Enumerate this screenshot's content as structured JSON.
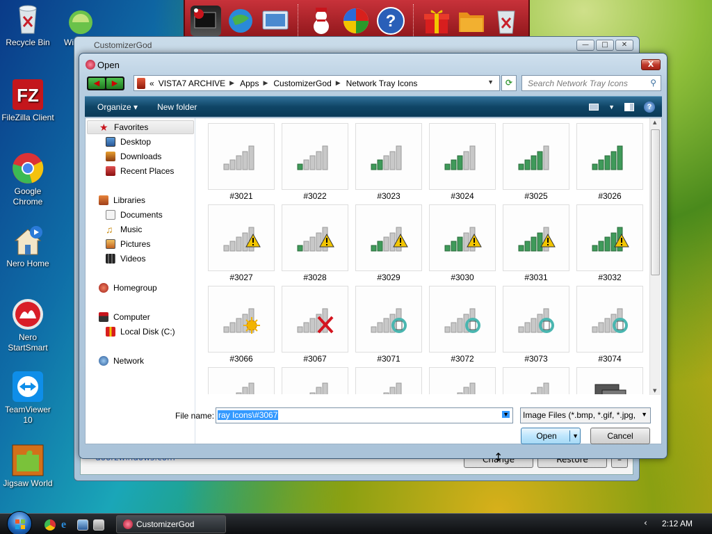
{
  "desktop": {
    "icons": [
      {
        "label": "Recycle Bin",
        "icon": "recycle-bin-icon"
      },
      {
        "label": "FileZilla Client",
        "icon": "filezilla-icon"
      },
      {
        "label": "Google Chrome",
        "icon": "chrome-icon"
      },
      {
        "label": "Nero Home",
        "icon": "nero-home-icon"
      },
      {
        "label": "Nero StartSmart",
        "icon": "nero-startsmart-icon"
      },
      {
        "label": "TeamViewer 10",
        "icon": "teamviewer-icon"
      },
      {
        "label": "Jigsaw World",
        "icon": "jigsaw-icon"
      },
      {
        "label": "Wi L",
        "icon": "windows-live-icon"
      }
    ]
  },
  "toolbar_icons": [
    "computer-santa-icon",
    "network-globe-icon",
    "display-icon",
    "snowman-icon",
    "security-shield-icon",
    "help-icon",
    "gift-icon",
    "folder-icon",
    "recycle-bin-icon"
  ],
  "back_window": {
    "title": "CustomizerGod",
    "link_text": "doorzwindows.com",
    "change_label": "Change",
    "restore_label": "Restore",
    "minus_label": "–"
  },
  "dialog": {
    "title": "Open",
    "close_label": "X",
    "address": {
      "prefix": "«",
      "crumbs": [
        "VISTA7 ARCHIVE",
        "Apps",
        "CustomizerGod",
        "Network Tray Icons"
      ]
    },
    "search_placeholder": "Search Network Tray Icons",
    "commands": {
      "organize": "Organize ▾",
      "new_folder": "New folder"
    },
    "nav": {
      "favorites": "Favorites",
      "desktop": "Desktop",
      "downloads": "Downloads",
      "recent": "Recent Places",
      "libraries": "Libraries",
      "documents": "Documents",
      "music": "Music",
      "pictures": "Pictures",
      "videos": "Videos",
      "homegroup": "Homegroup",
      "computer": "Computer",
      "local_disk": "Local Disk (C:)",
      "network": "Network"
    },
    "files": [
      {
        "name": "#3021",
        "bars": 0,
        "overlay": "none"
      },
      {
        "name": "#3022",
        "bars": 1,
        "overlay": "none"
      },
      {
        "name": "#3023",
        "bars": 2,
        "overlay": "none"
      },
      {
        "name": "#3024",
        "bars": 3,
        "overlay": "none"
      },
      {
        "name": "#3025",
        "bars": 4,
        "overlay": "none"
      },
      {
        "name": "#3026",
        "bars": 5,
        "overlay": "none"
      },
      {
        "name": "#3027",
        "bars": 0,
        "overlay": "warning"
      },
      {
        "name": "#3028",
        "bars": 1,
        "overlay": "warning"
      },
      {
        "name": "#3029",
        "bars": 2,
        "overlay": "warning"
      },
      {
        "name": "#3030",
        "bars": 3,
        "overlay": "warning"
      },
      {
        "name": "#3031",
        "bars": 4,
        "overlay": "warning"
      },
      {
        "name": "#3032",
        "bars": 5,
        "overlay": "warning"
      },
      {
        "name": "#3066",
        "bars": 0,
        "overlay": "sun"
      },
      {
        "name": "#3067",
        "bars": 0,
        "overlay": "error"
      },
      {
        "name": "#3071",
        "bars": 0,
        "overlay": "busy"
      },
      {
        "name": "#3072",
        "bars": 0,
        "overlay": "busy"
      },
      {
        "name": "#3073",
        "bars": 0,
        "overlay": "busy"
      },
      {
        "name": "#3074",
        "bars": 0,
        "overlay": "busy"
      }
    ],
    "file_name_label": "File name:",
    "file_name_value": "ray Icons\\#3067",
    "file_type": "Image Files (*.bmp, *.gif, *.jpg,",
    "open_label": "Open",
    "cancel_label": "Cancel"
  },
  "taskbar": {
    "task_label": "CustomizerGod",
    "clock": "2:12 AM",
    "tray_chevron": "‹"
  },
  "colors": {
    "accent": "#0f4566",
    "signal_green": "#3f9a5a",
    "warning_yellow": "#f2c500",
    "error_red": "#d4141e",
    "busy_teal": "#4ab6b0"
  }
}
